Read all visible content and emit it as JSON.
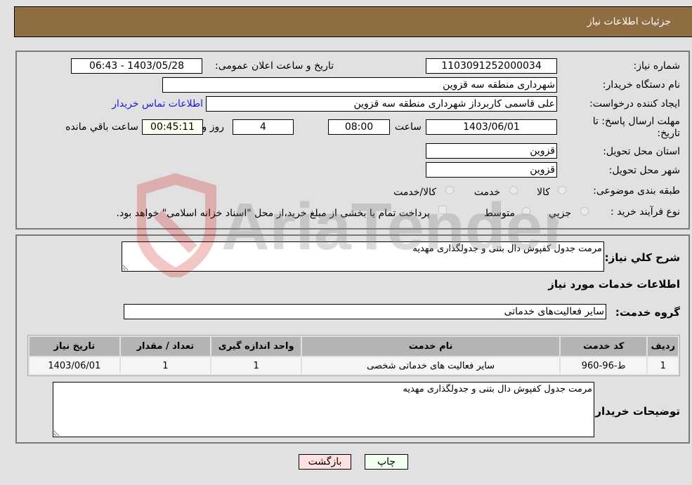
{
  "header": {
    "title": "جزئیات اطلاعات نیاز"
  },
  "form": {
    "need_number_label": "شماره نیاز:",
    "need_number": "1103091252000034",
    "announce_label": "تاریخ و ساعت اعلان عمومی:",
    "announce_value": "1403/05/28 - 06:43",
    "buyer_org_label": "نام دستگاه خریدار:",
    "buyer_org": "شهرداری منطقه سه قزوین",
    "creator_label": "ایجاد کننده درخواست:",
    "creator": "علی قاسمی کاربرداز شهرداری منطقه سه قزوین",
    "contact_link": "اطلاعات تماس خریدار",
    "deadline_label_1": "مهلت ارسال پاسخ: تا",
    "deadline_label_2": "تاریخ:",
    "deadline_date": "1403/06/01",
    "time_label": "ساعت",
    "deadline_time": "08:00",
    "days": "4",
    "days_label": "روز و",
    "remaining_time": "00:45:11",
    "remaining_label": "ساعت باقي مانده",
    "province_label": "استان محل تحویل:",
    "province": "قزوین",
    "city_label": "شهر محل تحویل:",
    "city": "قزوین",
    "category_label": "طبقه بندی موضوعی:",
    "category_options": [
      "کالا",
      "خدمت",
      "کالا/خدمت"
    ],
    "category_selected": "خدمت",
    "purchase_type_label": "نوع فرآیند خرید :",
    "purchase_type_options": [
      "جزيي",
      "متوسط"
    ],
    "purchase_type_selected": "متوسط",
    "payment_note": "پرداخت تمام یا بخشی از مبلغ خرید،از محل \"اسناد خزانه اسلامی\" خواهد بود."
  },
  "details": {
    "description_label": "شرح کلي نياز:",
    "description": "مرمت جدول کفپوش دال بتنی و جدولگذاری مهدیه",
    "services_heading": "اطلاعات خدمات مورد نیاز",
    "service_group_label": "گروه خدمت:",
    "service_group": "سایر فعالیت‌های خدماتی",
    "table": {
      "headers": [
        "ردیف",
        "کد خدمت",
        "نام خدمت",
        "واحد اندازه گیری",
        "تعداد / مقدار",
        "تاریخ نیاز"
      ],
      "rows": [
        [
          "1",
          "ط-96-960",
          "سایر فعالیت های خدماتی شخصی",
          "1",
          "1",
          "1403/06/01"
        ]
      ]
    },
    "buyer_notes_label": "توضیحات خریدار:",
    "buyer_notes": "مرمت جدول کفپوش دال بتنی و جدولگذاری مهدیه"
  },
  "buttons": {
    "print": "چاپ",
    "back": "بازگشت"
  },
  "watermark": {
    "text": "AriaTender.neT"
  },
  "colors": {
    "header_bg": "#8e6d43",
    "print_bg": "#f0fff0",
    "back_bg": "#ffe0e0",
    "link": "#1a1adb"
  }
}
